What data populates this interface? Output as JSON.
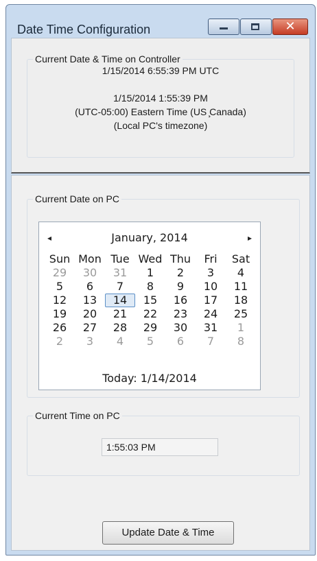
{
  "window": {
    "title": "Date Time Configuration",
    "caption_buttons": {
      "minimize_icon": "minimize-icon",
      "maximize_icon": "maximize-icon",
      "close_icon": "close-icon",
      "close_glyph": "✕"
    },
    "accent": "#c9dbef",
    "close_color": "#c53c24"
  },
  "controller": {
    "legend": "Current Date & Time on Controller",
    "utc_time": "1/15/2014 6:55:39 PM UTC",
    "local_time": "1/15/2014 1:55:39 PM",
    "timezone": "(UTC-05:00) Eastern Time (US ̧Canada)",
    "timezone_note": "(Local PC's timezone)"
  },
  "pc_date": {
    "legend": "Current Date on PC",
    "calendar": {
      "prev_glyph": "◂",
      "next_glyph": "▸",
      "month_label": "January, 2014",
      "weekdays": [
        "Sun",
        "Mon",
        "Tue",
        "Wed",
        "Thu",
        "Fri",
        "Sat"
      ],
      "weeks": [
        [
          "29",
          "30",
          "31",
          "1",
          "2",
          "3",
          "4"
        ],
        [
          "5",
          "6",
          "7",
          "8",
          "9",
          "10",
          "11"
        ],
        [
          "12",
          "13",
          "14",
          "15",
          "16",
          "17",
          "18"
        ],
        [
          "19",
          "20",
          "21",
          "22",
          "23",
          "24",
          "25"
        ],
        [
          "26",
          "27",
          "28",
          "29",
          "30",
          "31",
          "1"
        ],
        [
          "2",
          "3",
          "4",
          "5",
          "6",
          "7",
          "8"
        ]
      ],
      "selected_day": "14",
      "today_label": "Today: 1/14/2014"
    }
  },
  "pc_time": {
    "legend": "Current Time on PC",
    "value": "1:55:03 PM"
  },
  "actions": {
    "update_label": "Update Date & Time"
  }
}
